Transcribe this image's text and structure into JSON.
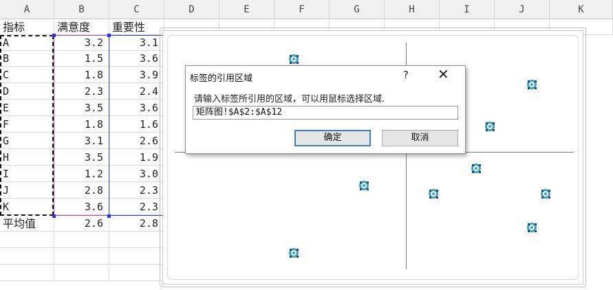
{
  "columns": [
    "A",
    "B",
    "C",
    "D",
    "E",
    "F",
    "G",
    "H",
    "I",
    "J",
    "K"
  ],
  "sheet": {
    "headers": [
      "指标",
      "满意度",
      "重要性"
    ],
    "rows": [
      {
        "label": "A",
        "b": "3.2",
        "c": "3.1"
      },
      {
        "label": "B",
        "b": "1.5",
        "c": "3.6"
      },
      {
        "label": "C",
        "b": "1.8",
        "c": "3.9"
      },
      {
        "label": "D",
        "b": "2.3",
        "c": "2.4"
      },
      {
        "label": "E",
        "b": "3.5",
        "c": "3.6"
      },
      {
        "label": "F",
        "b": "1.8",
        "c": "1.6"
      },
      {
        "label": "G",
        "b": "3.1",
        "c": "2.6"
      },
      {
        "label": "H",
        "b": "3.5",
        "c": "1.9"
      },
      {
        "label": "I",
        "b": "1.2",
        "c": "3.0"
      },
      {
        "label": "J",
        "b": "2.8",
        "c": "2.3"
      },
      {
        "label": "K",
        "b": "3.6",
        "c": "2.3"
      }
    ],
    "avg": {
      "label": "平均值",
      "b": "2.6",
      "c": "2.8"
    }
  },
  "chart_data": {
    "type": "scatter",
    "x_cross": 2.6,
    "y_cross": 2.8,
    "points": [
      {
        "x": 3.2,
        "y": 3.1
      },
      {
        "x": 1.5,
        "y": 3.6
      },
      {
        "x": 1.8,
        "y": 3.9
      },
      {
        "x": 2.3,
        "y": 2.4
      },
      {
        "x": 3.5,
        "y": 3.6
      },
      {
        "x": 1.8,
        "y": 1.6
      },
      {
        "x": 3.1,
        "y": 2.6
      },
      {
        "x": 3.5,
        "y": 1.9
      },
      {
        "x": 1.2,
        "y": 3.0
      },
      {
        "x": 2.8,
        "y": 2.3
      },
      {
        "x": 3.6,
        "y": 2.3
      }
    ],
    "marker_color": "#41a0c8"
  },
  "dialog": {
    "title": "标签的引用区域",
    "help": "?",
    "close": "✕",
    "prompt": "请输入标签所引用的区域，可以用鼠标选择区域.",
    "input_value": "矩阵图!$A$2:$A$12",
    "ok_label": "确定",
    "cancel_label": "取消"
  }
}
